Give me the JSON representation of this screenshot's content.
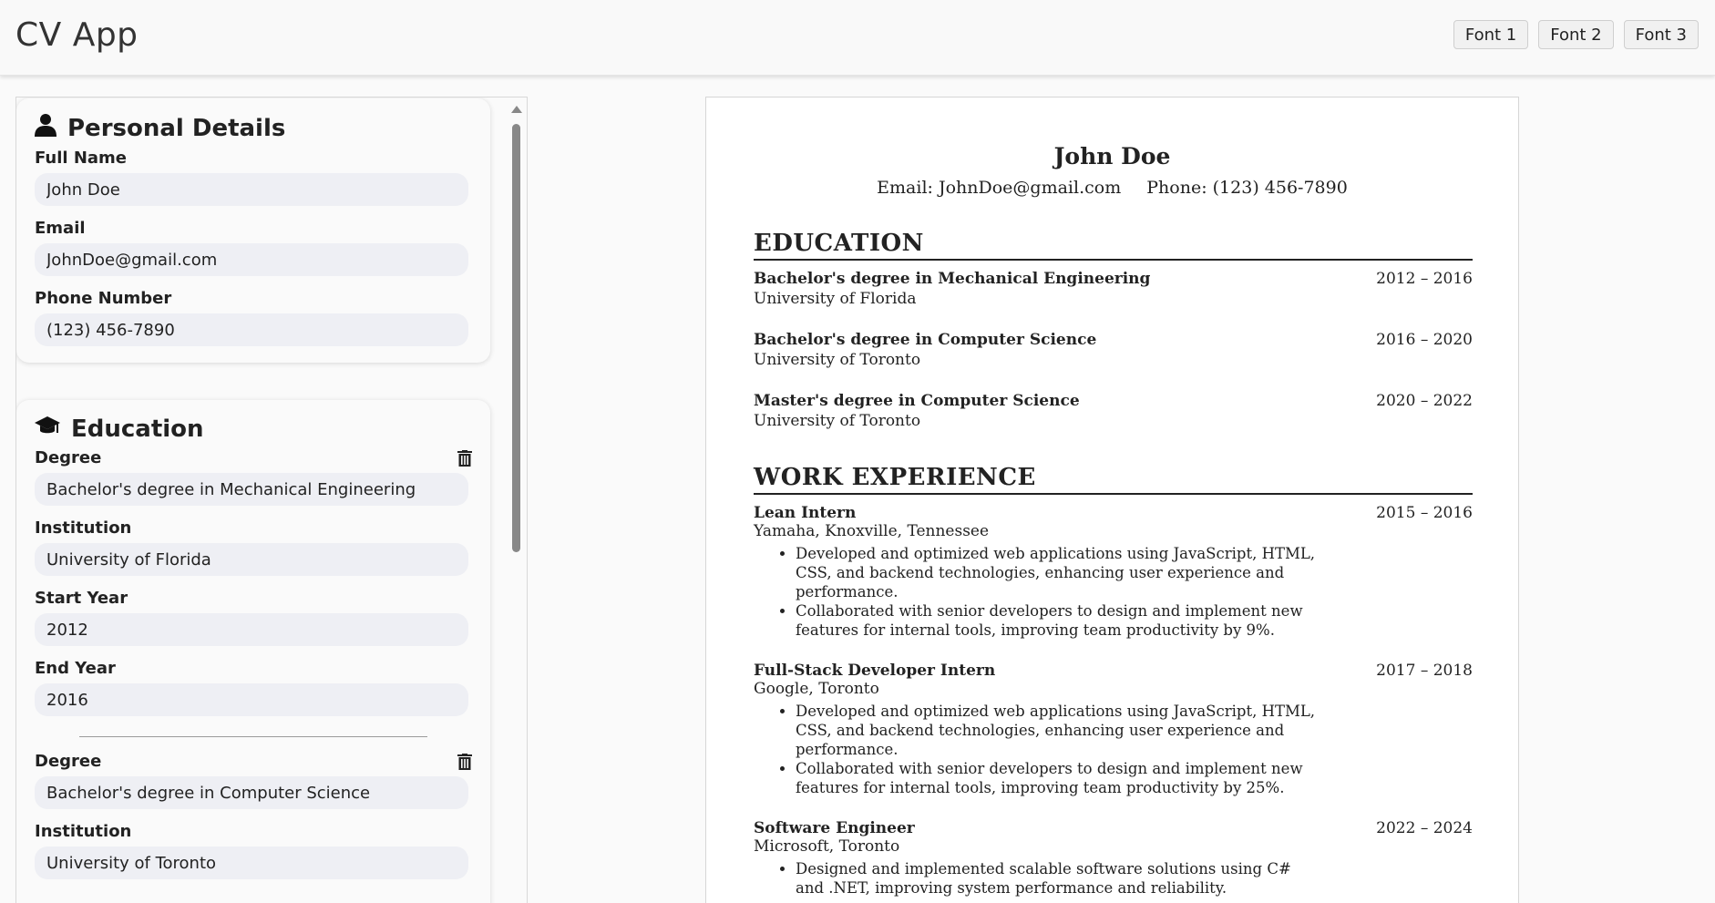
{
  "app": {
    "title": "CV App"
  },
  "fonts": [
    "Font 1",
    "Font 2",
    "Font 3"
  ],
  "personal": {
    "heading": "Personal Details",
    "full_name_label": "Full Name",
    "full_name": "John Doe",
    "email_label": "Email",
    "email": "JohnDoe@gmail.com",
    "phone_label": "Phone Number",
    "phone": "(123) 456-7890"
  },
  "education_form": {
    "heading": "Education",
    "degree_label": "Degree",
    "institution_label": "Institution",
    "start_label": "Start Year",
    "end_label": "End Year",
    "entries": [
      {
        "degree": "Bachelor's degree in Mechanical Engineering",
        "institution": "University of Florida",
        "start": "2012",
        "end": "2016"
      },
      {
        "degree": "Bachelor's degree in Computer Science",
        "institution": "University of Toronto"
      }
    ]
  },
  "resume": {
    "name": "John Doe",
    "email_line": "Email: JohnDoe@gmail.com",
    "phone_line": "Phone: (123) 456-7890",
    "education_title": "EDUCATION",
    "education": [
      {
        "degree": "Bachelor's degree in Mechanical Engineering",
        "institution": "University of Florida",
        "years": "2012 – 2016"
      },
      {
        "degree": "Bachelor's degree in Computer Science",
        "institution": "University of Toronto",
        "years": "2016 – 2020"
      },
      {
        "degree": "Master's degree in Computer Science",
        "institution": "University of Toronto",
        "years": "2020 – 2022"
      }
    ],
    "work_title": "WORK EXPERIENCE",
    "work": [
      {
        "role": "Lean Intern",
        "company": "Yamaha, Knoxville, Tennessee",
        "years": "2015 – 2016",
        "bullets": [
          "Developed and optimized web applications using JavaScript, HTML, CSS, and backend technologies, enhancing user experience and performance.",
          "Collaborated with senior developers to design and implement new features for internal tools, improving team productivity by 9%."
        ]
      },
      {
        "role": "Full-Stack Developer Intern",
        "company": "Google, Toronto",
        "years": "2017 – 2018",
        "bullets": [
          "Developed and optimized web applications using JavaScript, HTML, CSS, and backend technologies, enhancing user experience and performance.",
          "Collaborated with senior developers to design and implement new features for internal tools, improving team productivity by 25%."
        ]
      },
      {
        "role": "Software Engineer",
        "company": "Microsoft, Toronto",
        "years": "2022 – 2024",
        "bullets": [
          "Designed and implemented scalable software solutions using C# and .NET, improving system performance and reliability."
        ]
      }
    ]
  }
}
